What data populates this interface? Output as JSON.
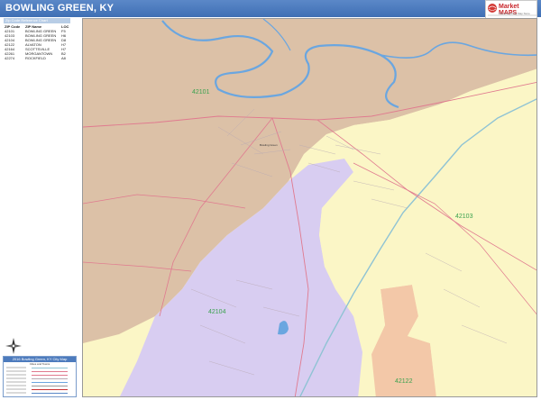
{
  "header": {
    "title": "BOWLING GREEN, KY"
  },
  "logo": {
    "brand": "Market MAPS",
    "tagline": "The Everything Map Store"
  },
  "zip_table": {
    "title": "Zip Code Reference Chart",
    "columns": [
      "ZIP Code",
      "ZIP Name",
      "LOC"
    ],
    "rows": [
      [
        "42101",
        "BOWLING GREEN",
        "F5"
      ],
      [
        "42103",
        "BOWLING GREEN",
        "H6"
      ],
      [
        "42104",
        "BOWLING GREEN",
        "D8"
      ],
      [
        "42122",
        "ALVATON",
        "H7"
      ],
      [
        "42164",
        "SCOTTSVILLE",
        "H7"
      ],
      [
        "42261",
        "MORGANTOWN",
        "B2"
      ],
      [
        "42274",
        "ROCKFIELD",
        "A8"
      ]
    ]
  },
  "map": {
    "zip_labels": [
      "42101",
      "42103",
      "42104",
      "42122"
    ],
    "place_labels": [
      "Bowling Green"
    ],
    "colors": {
      "zone_42101": "#dcc1a7",
      "zone_42103": "#fbf6c6",
      "zone_42104": "#d8cdf1",
      "zone_42122": "#f3c8a8",
      "water": "#6aa6e0",
      "roads": "#e07a8f",
      "streets": "#b9a9b3"
    }
  },
  "legend": {
    "title": "2016 Bowling Green, KY City Map",
    "subtitle": "Cities and Towns"
  }
}
